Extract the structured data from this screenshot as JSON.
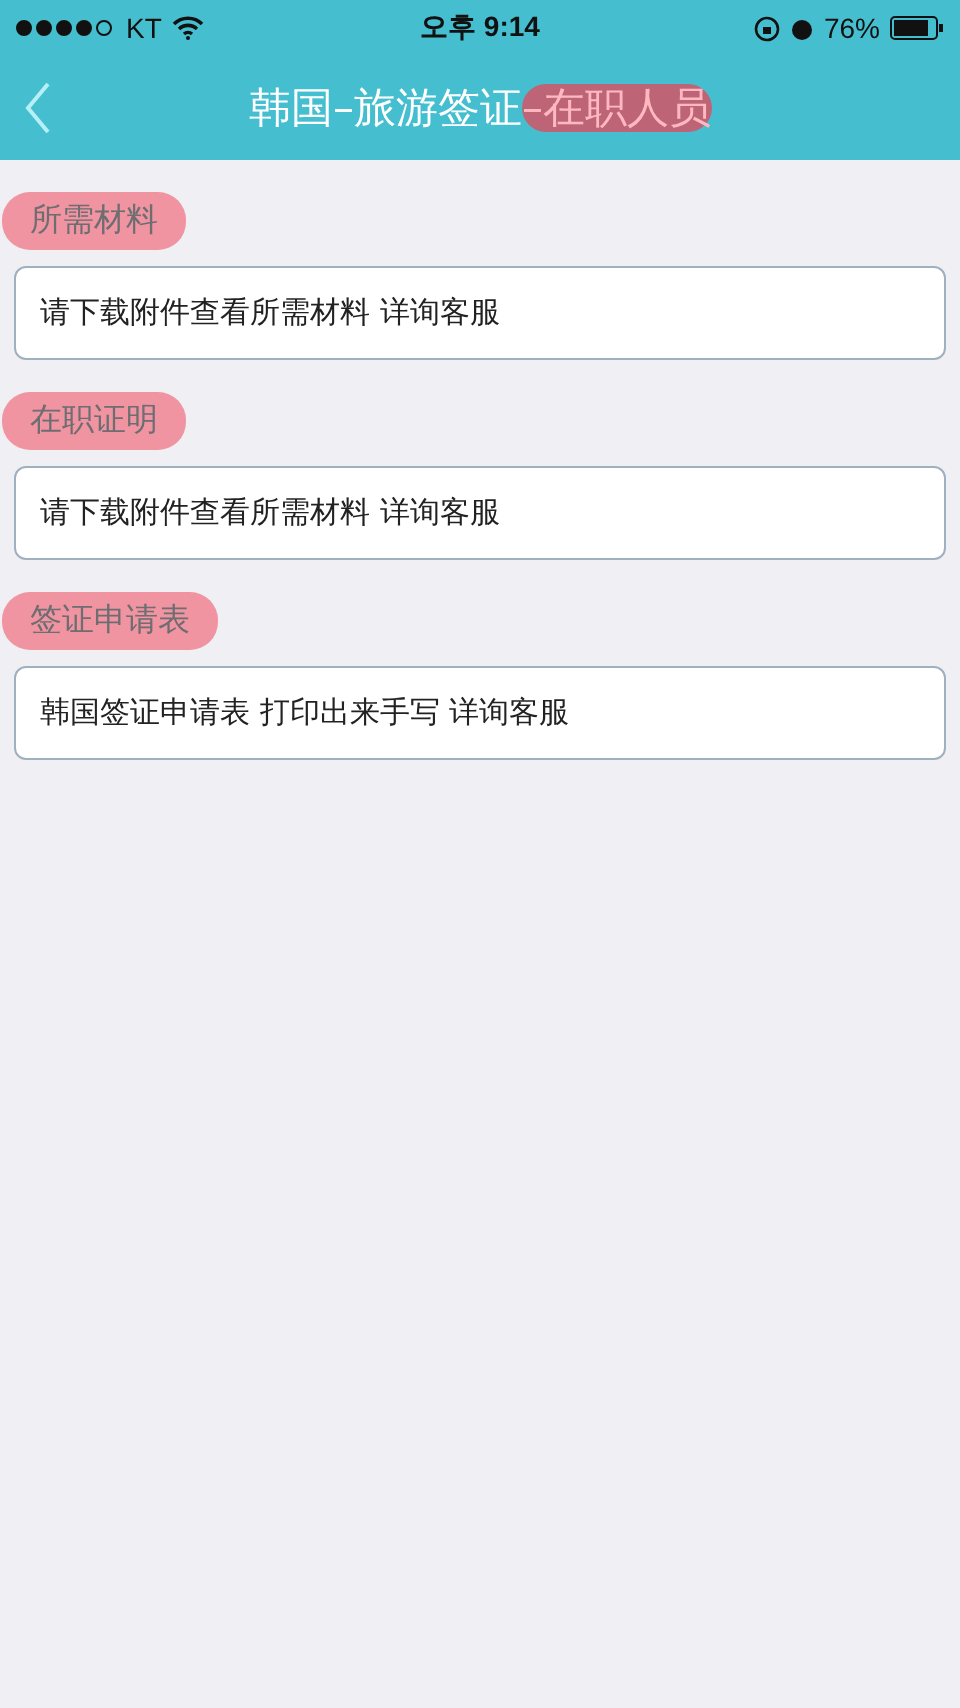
{
  "status_bar": {
    "carrier": "KT",
    "time": "오후 9:14",
    "battery": "76%"
  },
  "nav": {
    "title": "韩国–旅游签证",
    "title_highlighted": "–在职人员"
  },
  "sections": [
    {
      "heading": "所需材料",
      "highlighted": true,
      "text": "请下载附件查看所需材料 详询客服"
    },
    {
      "heading": "在职证明",
      "highlighted": true,
      "text": "请下载附件查看所需材料 详询客服"
    },
    {
      "heading": "签证申请表",
      "highlighted": true,
      "text": "韩国签证申请表 打印出来手写 详询客服"
    }
  ]
}
